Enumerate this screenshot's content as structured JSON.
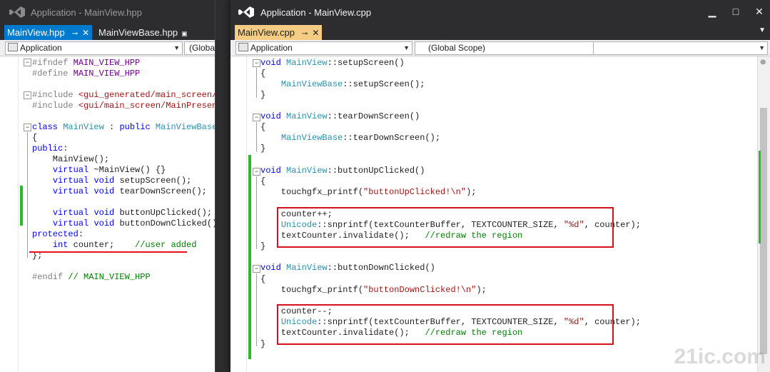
{
  "left_window": {
    "title": "Application - MainView.hpp",
    "tabs": [
      {
        "label": "MainView.hpp",
        "active": true
      },
      {
        "label": "MainViewBase.hpp",
        "active": false
      }
    ],
    "nav": {
      "project": "Application",
      "scope": "(Global"
    },
    "code": [
      "#ifndef MAIN_VIEW_HPP",
      "#define MAIN_VIEW_HPP",
      "",
      "#include <gui_generated/main_screen/MainVi",
      "#include <gui/main_screen/MainPresenter.hp",
      "",
      "class MainView : public MainViewBase",
      "{",
      "public:",
      "    MainView();",
      "    virtual ~MainView() {}",
      "    virtual void setupScreen();",
      "    virtual void tearDownScreen();",
      "",
      "    virtual void buttonUpClicked();",
      "    virtual void buttonDownClicked();",
      "protected:",
      "    int counter;    //user added",
      "};",
      "",
      "#endif // MAIN_VIEW_HPP"
    ]
  },
  "right_window": {
    "title": "Application - MainView.cpp",
    "tabs": [
      {
        "label": "MainView.cpp",
        "active": true
      }
    ],
    "nav": {
      "project": "Application",
      "scope": "(Global Scope)",
      "member": ""
    },
    "code": [
      "void MainView::setupScreen()",
      "{",
      "    MainViewBase::setupScreen();",
      "}",
      "",
      "void MainView::tearDownScreen()",
      "{",
      "    MainViewBase::tearDownScreen();",
      "}",
      "",
      "void MainView::buttonUpClicked()",
      "{",
      "    touchgfx_printf(\"buttonUpClicked!\\n\");",
      "",
      "    counter++;",
      "    Unicode::snprintf(textCounterBuffer, TEXTCOUNTER_SIZE, \"%d\", counter);",
      "    textCounter.invalidate();   //redraw the region",
      "}",
      "",
      "void MainView::buttonDownClicked()",
      "{",
      "    touchgfx_printf(\"buttonDownClicked!\\n\");",
      "",
      "    counter--;",
      "    Unicode::snprintf(textCounterBuffer, TEXTCOUNTER_SIZE, \"%d\", counter);",
      "    textCounter.invalidate();   //redraw the region",
      "}"
    ]
  },
  "icons": {
    "vs_logo": "visual-studio-logo-icon",
    "pin": "pin-icon",
    "close": "close-icon",
    "minimize": "minimize-icon",
    "maximize": "maximize-icon",
    "dropdown": "chevron-down-icon"
  },
  "watermark": "21ic.com",
  "colors": {
    "keyword": "#0000ff",
    "type": "#2b91af",
    "preprocessor": "#808080",
    "macro": "#6f008a",
    "string": "#a31515",
    "comment": "#008000",
    "highlight_box": "#d4111b",
    "change_bar": "#2bba2b",
    "active_tab_blue": "#007acc",
    "active_tab_yellow": "#f5cc84"
  }
}
